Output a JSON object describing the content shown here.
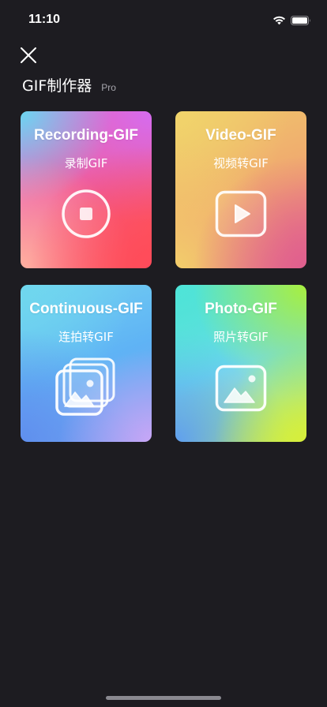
{
  "status_bar": {
    "time": "11:10",
    "icons": [
      "wifi-icon",
      "battery-icon"
    ]
  },
  "header": {
    "close_icon": "close-icon",
    "title": "GIF制作器",
    "badge": "Pro"
  },
  "cards": [
    {
      "title": "Recording-GIF",
      "subtitle": "录制GIF",
      "icon": "record-stop-icon",
      "colors": [
        "#6ad6f0",
        "#e26ee0",
        "#ff4a5a"
      ]
    },
    {
      "title": "Video-GIF",
      "subtitle": "视频转GIF",
      "icon": "video-play-icon",
      "colors": [
        "#f1d46b",
        "#f0a670",
        "#e05f8e"
      ]
    },
    {
      "title": "Continuous-GIF",
      "subtitle": "连拍转GIF",
      "icon": "stacked-photos-icon",
      "colors": [
        "#6fd7ee",
        "#5fb3f5",
        "#c8a6f6"
      ]
    },
    {
      "title": "Photo-GIF",
      "subtitle": "照片转GIF",
      "icon": "photo-icon",
      "colors": [
        "#4ee4d8",
        "#a8ef3e",
        "#5f9ff0"
      ]
    }
  ],
  "theme": {
    "background": "#1d1c21",
    "text": "#ffffff",
    "muted": "#a7a6ad"
  }
}
